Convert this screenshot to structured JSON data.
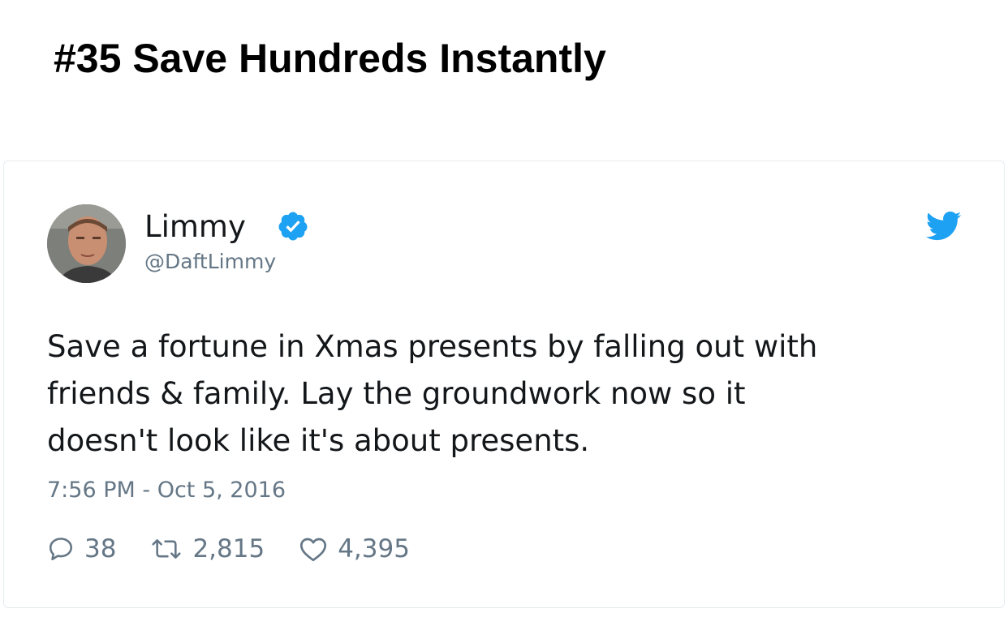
{
  "headline": "#35 Save Hundreds Instantly",
  "tweet": {
    "display_name": "Limmy",
    "handle": "@DaftLimmy",
    "text_lines": [
      "Save a fortune in Xmas presents by falling out with",
      "friends & family. Lay the groundwork now so it",
      "doesn't look like it's about presents."
    ],
    "timestamp": "7:56 PM - Oct 5, 2016",
    "reply_count": "38",
    "retweet_count": "2,815",
    "like_count": "4,395"
  },
  "icons": {
    "verified": "verified-badge-icon",
    "brand": "twitter-bird-icon",
    "reply": "reply-icon",
    "retweet": "retweet-icon",
    "like": "heart-icon"
  },
  "colors": {
    "accent_blue": "#1da1f2",
    "text_primary": "#14171a",
    "text_secondary": "#657786",
    "card_border": "#e6ecf0"
  }
}
